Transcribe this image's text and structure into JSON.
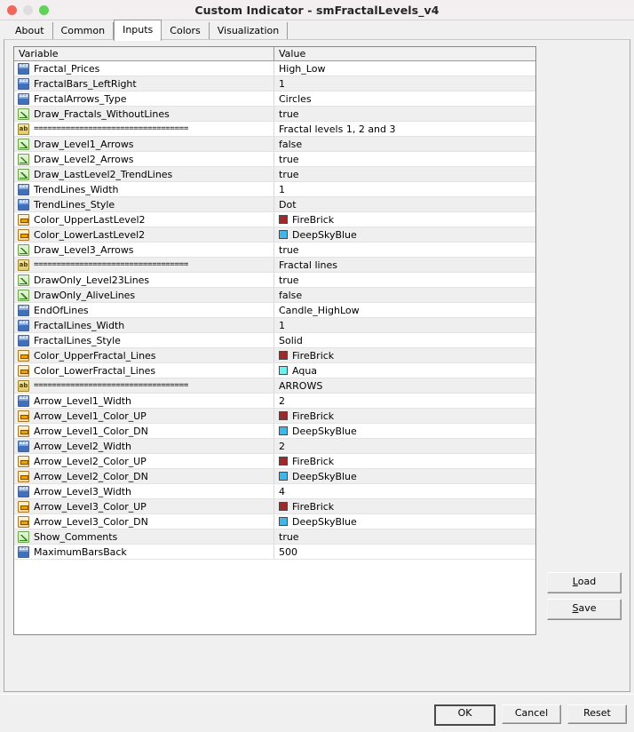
{
  "window": {
    "title": "Custom Indicator - smFractalLevels_v4",
    "traffic_lights": [
      "close-button",
      "minimize-button",
      "zoom-button"
    ]
  },
  "tabs": [
    {
      "label": "About",
      "active": false
    },
    {
      "label": "Common",
      "active": false
    },
    {
      "label": "Inputs",
      "active": true
    },
    {
      "label": "Colors",
      "active": false
    },
    {
      "label": "Visualization",
      "active": false
    }
  ],
  "table": {
    "headers": {
      "variable": "Variable",
      "value": "Value"
    },
    "rows": [
      {
        "icon": "int",
        "name": "Fractal_Prices",
        "value": "High_Low"
      },
      {
        "icon": "int",
        "name": "FractalBars_LeftRight",
        "value": "1"
      },
      {
        "icon": "int",
        "name": "FractalArrows_Type",
        "value": "Circles"
      },
      {
        "icon": "bool",
        "name": "Draw_Fractals_WithoutLines",
        "value": "true"
      },
      {
        "icon": "str",
        "name": "==================================",
        "value": "Fractal levels 1, 2 and 3"
      },
      {
        "icon": "bool",
        "name": "Draw_Level1_Arrows",
        "value": "false"
      },
      {
        "icon": "bool",
        "name": "Draw_Level2_Arrows",
        "value": "true"
      },
      {
        "icon": "bool",
        "name": "Draw_LastLevel2_TrendLines",
        "value": "true"
      },
      {
        "icon": "int",
        "name": "TrendLines_Width",
        "value": "1"
      },
      {
        "icon": "int",
        "name": "TrendLines_Style",
        "value": "Dot"
      },
      {
        "icon": "color",
        "name": "Color_UpperLastLevel2",
        "value": "FireBrick",
        "swatch": "#9c2a28"
      },
      {
        "icon": "color",
        "name": "Color_LowerLastLevel2",
        "value": "DeepSkyBlue",
        "swatch": "#41b6e8"
      },
      {
        "icon": "bool",
        "name": "Draw_Level3_Arrows",
        "value": "true"
      },
      {
        "icon": "str",
        "name": "==================================",
        "value": "Fractal lines"
      },
      {
        "icon": "bool",
        "name": "DrawOnly_Level23Lines",
        "value": "true"
      },
      {
        "icon": "bool",
        "name": "DrawOnly_AliveLines",
        "value": "false"
      },
      {
        "icon": "int",
        "name": "EndOfLines",
        "value": "Candle_HighLow"
      },
      {
        "icon": "int",
        "name": "FractalLines_Width",
        "value": "1"
      },
      {
        "icon": "int",
        "name": "FractalLines_Style",
        "value": "Solid"
      },
      {
        "icon": "color",
        "name": "Color_UpperFractal_Lines",
        "value": "FireBrick",
        "swatch": "#9c2a28"
      },
      {
        "icon": "color",
        "name": "Color_LowerFractal_Lines",
        "value": "Aqua",
        "swatch": "#6ff0f0"
      },
      {
        "icon": "str",
        "name": "==================================",
        "value": "ARROWS"
      },
      {
        "icon": "int",
        "name": "Arrow_Level1_Width",
        "value": "2"
      },
      {
        "icon": "color",
        "name": "Arrow_Level1_Color_UP",
        "value": "FireBrick",
        "swatch": "#9c2a28"
      },
      {
        "icon": "color",
        "name": "Arrow_Level1_Color_DN",
        "value": "DeepSkyBlue",
        "swatch": "#41b6e8"
      },
      {
        "icon": "int",
        "name": "Arrow_Level2_Width",
        "value": "2"
      },
      {
        "icon": "color",
        "name": "Arrow_Level2_Color_UP",
        "value": "FireBrick",
        "swatch": "#9c2a28"
      },
      {
        "icon": "color",
        "name": "Arrow_Level2_Color_DN",
        "value": "DeepSkyBlue",
        "swatch": "#41b6e8"
      },
      {
        "icon": "int",
        "name": "Arrow_Level3_Width",
        "value": "4"
      },
      {
        "icon": "color",
        "name": "Arrow_Level3_Color_UP",
        "value": "FireBrick",
        "swatch": "#9c2a28"
      },
      {
        "icon": "color",
        "name": "Arrow_Level3_Color_DN",
        "value": "DeepSkyBlue",
        "swatch": "#41b6e8"
      },
      {
        "icon": "bool",
        "name": "Show_Comments",
        "value": "true"
      },
      {
        "icon": "int",
        "name": "MaximumBarsBack",
        "value": "500"
      }
    ]
  },
  "side_buttons": [
    {
      "label": "Load",
      "accel": "L"
    },
    {
      "label": "Save",
      "accel": "S"
    }
  ],
  "dialog_buttons": [
    {
      "label": "OK",
      "default": true
    },
    {
      "label": "Cancel",
      "default": false
    },
    {
      "label": "Reset",
      "default": false
    }
  ]
}
